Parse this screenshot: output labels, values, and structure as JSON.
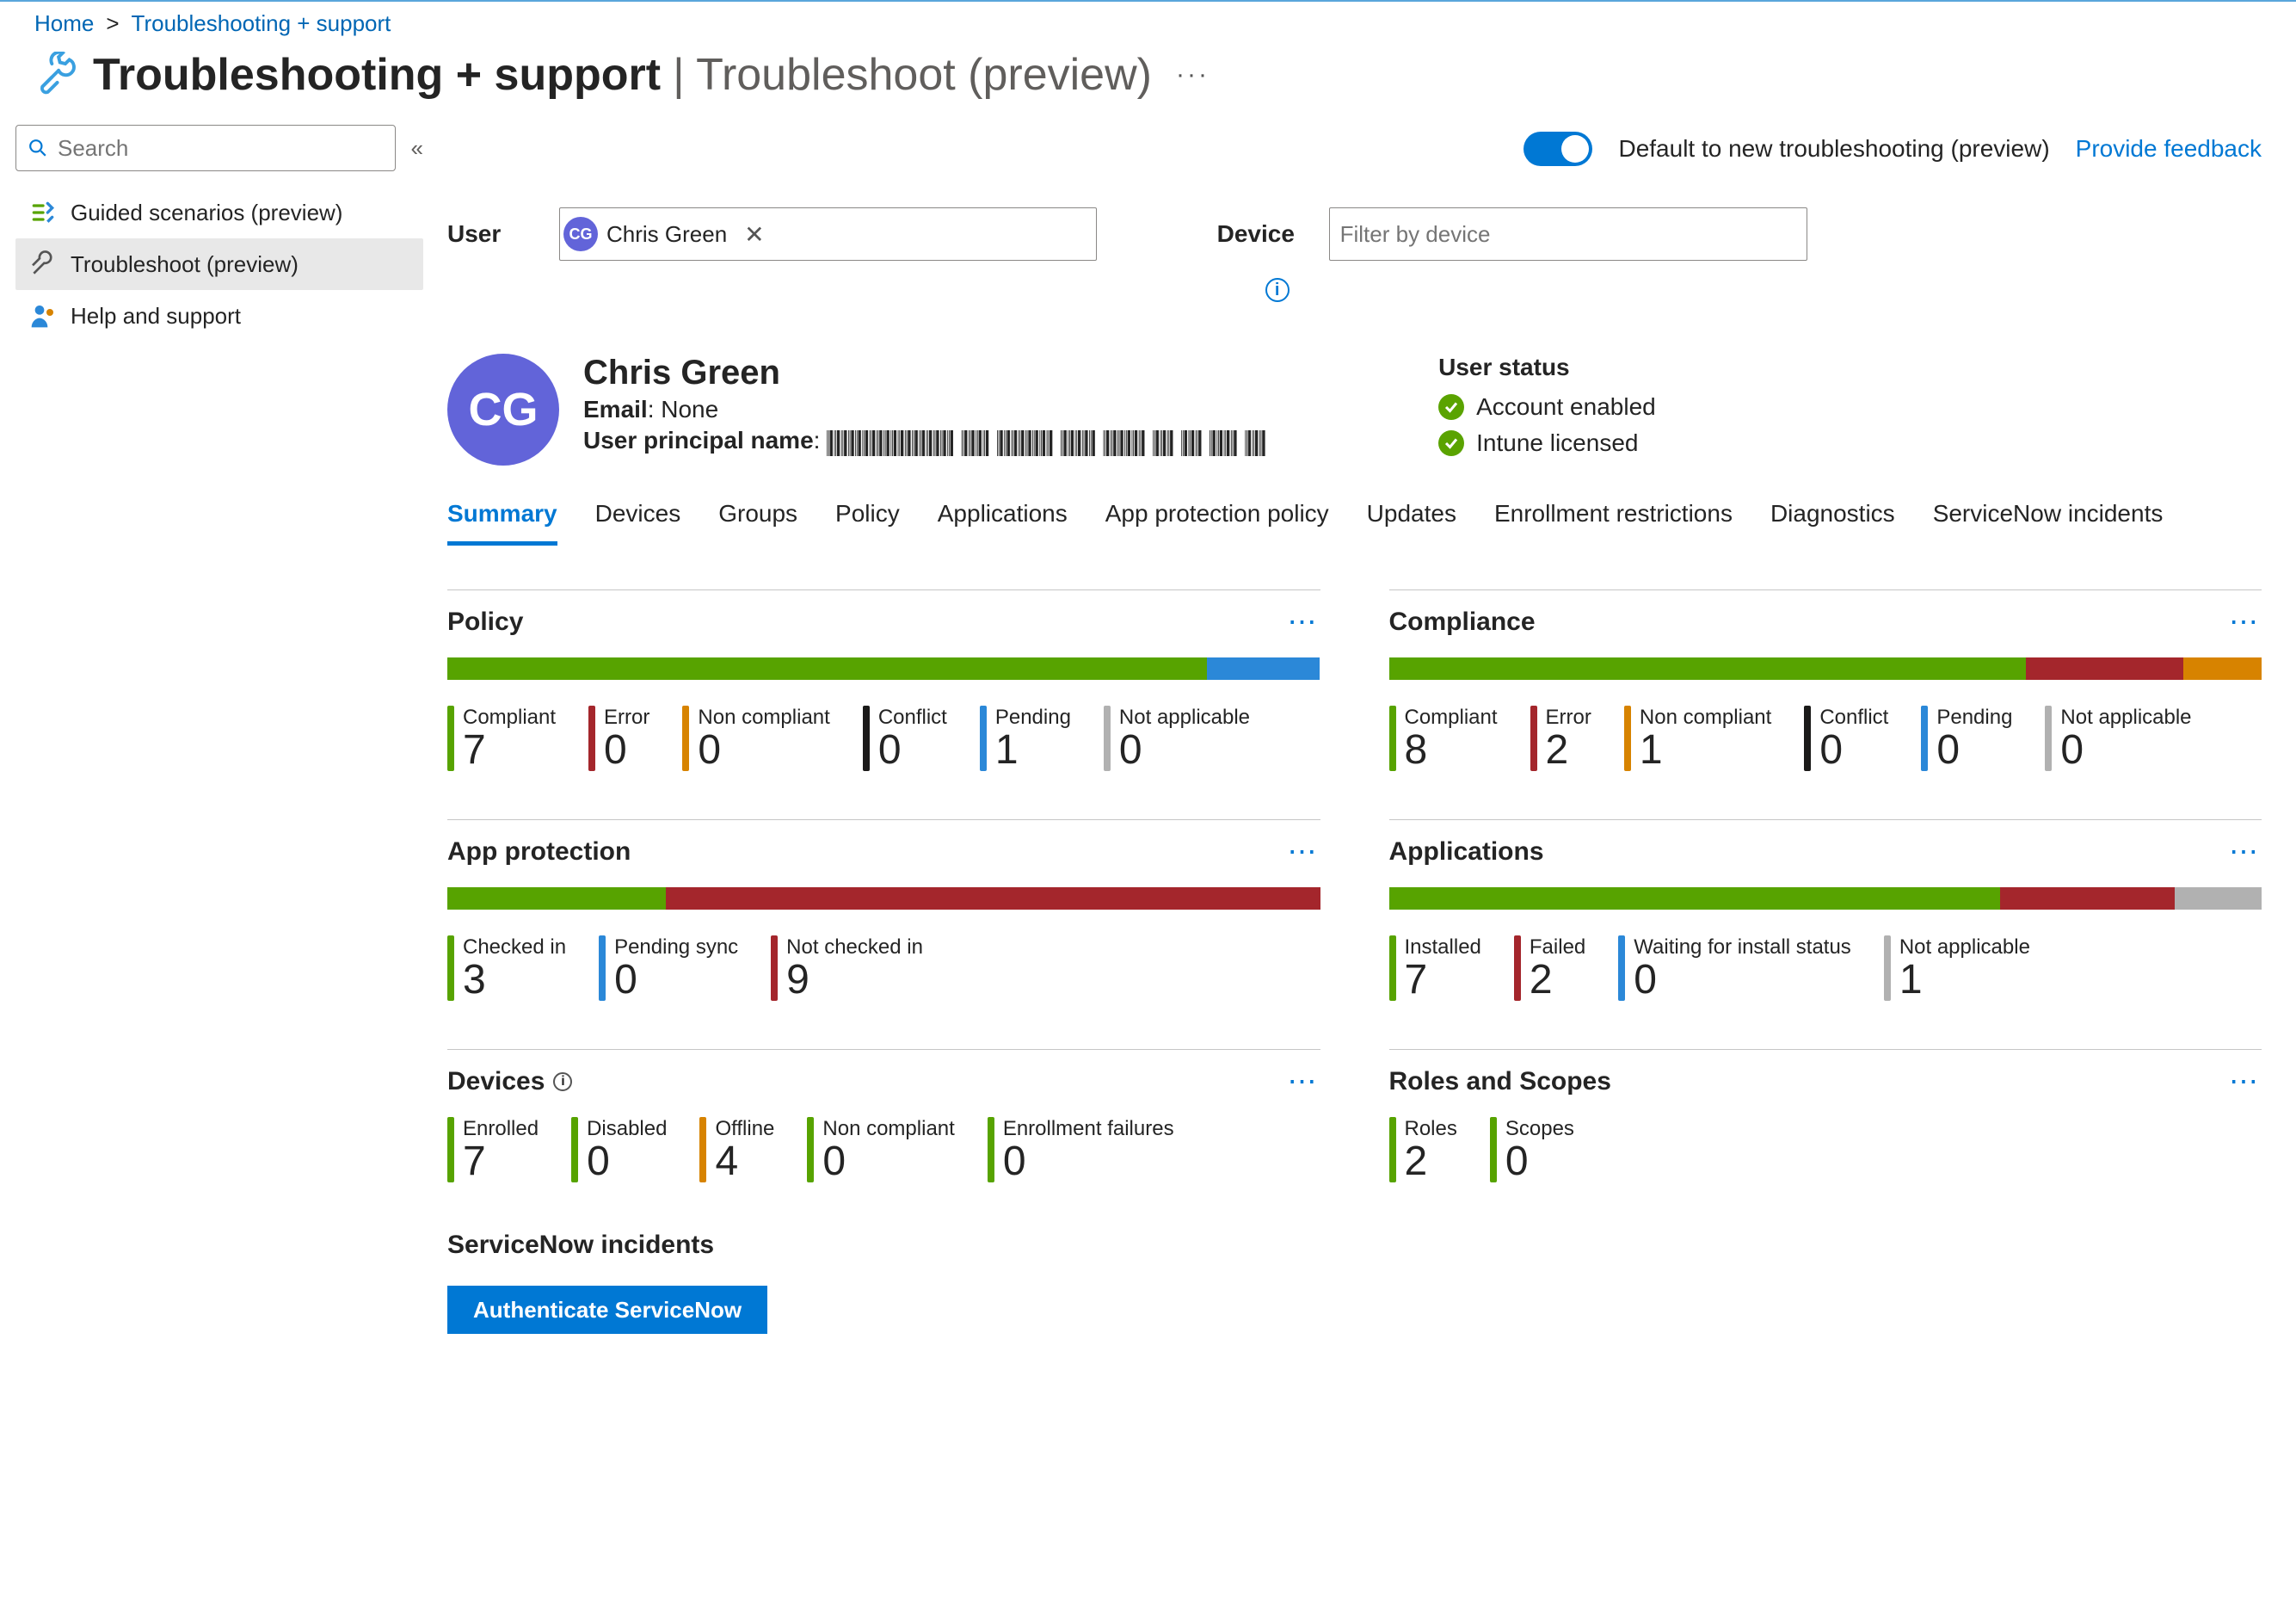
{
  "breadcrumb": {
    "home": "Home",
    "current": "Troubleshooting + support"
  },
  "title": {
    "main": "Troubleshooting + support",
    "sub": "Troubleshoot (preview)"
  },
  "sidebar": {
    "search_placeholder": "Search",
    "items": [
      {
        "label": "Guided scenarios (preview)"
      },
      {
        "label": "Troubleshoot (preview)"
      },
      {
        "label": "Help and support"
      }
    ]
  },
  "toolbar": {
    "toggle_label": "Default to new troubleshooting (preview)",
    "feedback": "Provide feedback"
  },
  "filters": {
    "user_label": "User",
    "user_chip": "Chris Green",
    "user_initials": "CG",
    "device_label": "Device",
    "device_placeholder": "Filter by device"
  },
  "user": {
    "initials": "CG",
    "name": "Chris Green",
    "email_label": "Email",
    "email_value": "None",
    "upn_label": "User principal name",
    "upn_value": "|||||||||||||||||| |||| |||||||| ||||| |||||| ||| ||| |||| |||"
  },
  "status": {
    "title": "User status",
    "rows": [
      {
        "label": "Account enabled"
      },
      {
        "label": "Intune licensed"
      }
    ]
  },
  "tabs": [
    "Summary",
    "Devices",
    "Groups",
    "Policy",
    "Applications",
    "App protection policy",
    "Updates",
    "Enrollment restrictions",
    "Diagnostics",
    "ServiceNow incidents"
  ],
  "cards": {
    "policy": {
      "title": "Policy",
      "bar": [
        {
          "c": "c-green",
          "w": 87
        },
        {
          "c": "c-blue",
          "w": 13
        }
      ],
      "metrics": [
        {
          "label": "Compliant",
          "value": "7",
          "c": "c-green"
        },
        {
          "label": "Error",
          "value": "0",
          "c": "c-red"
        },
        {
          "label": "Non compliant",
          "value": "0",
          "c": "c-orange"
        },
        {
          "label": "Conflict",
          "value": "0",
          "c": "c-black"
        },
        {
          "label": "Pending",
          "value": "1",
          "c": "c-blue"
        },
        {
          "label": "Not applicable",
          "value": "0",
          "c": "c-grey"
        }
      ]
    },
    "compliance": {
      "title": "Compliance",
      "bar": [
        {
          "c": "c-green",
          "w": 73
        },
        {
          "c": "c-red",
          "w": 18
        },
        {
          "c": "c-orange",
          "w": 9
        }
      ],
      "metrics": [
        {
          "label": "Compliant",
          "value": "8",
          "c": "c-green"
        },
        {
          "label": "Error",
          "value": "2",
          "c": "c-red"
        },
        {
          "label": "Non compliant",
          "value": "1",
          "c": "c-orange"
        },
        {
          "label": "Conflict",
          "value": "0",
          "c": "c-black"
        },
        {
          "label": "Pending",
          "value": "0",
          "c": "c-blue"
        },
        {
          "label": "Not applicable",
          "value": "0",
          "c": "c-grey"
        }
      ]
    },
    "app_protection": {
      "title": "App protection",
      "bar": [
        {
          "c": "c-green",
          "w": 25
        },
        {
          "c": "c-red",
          "w": 75
        }
      ],
      "metrics": [
        {
          "label": "Checked in",
          "value": "3",
          "c": "c-green"
        },
        {
          "label": "Pending sync",
          "value": "0",
          "c": "c-blue"
        },
        {
          "label": "Not checked in",
          "value": "9",
          "c": "c-red"
        }
      ]
    },
    "applications": {
      "title": "Applications",
      "bar": [
        {
          "c": "c-green",
          "w": 70
        },
        {
          "c": "c-red",
          "w": 20
        },
        {
          "c": "c-grey",
          "w": 10
        }
      ],
      "metrics": [
        {
          "label": "Installed",
          "value": "7",
          "c": "c-green"
        },
        {
          "label": "Failed",
          "value": "2",
          "c": "c-red"
        },
        {
          "label": "Waiting for install status",
          "value": "0",
          "c": "c-blue"
        },
        {
          "label": "Not applicable",
          "value": "1",
          "c": "c-grey"
        }
      ]
    },
    "devices": {
      "title": "Devices",
      "info": true,
      "bar": null,
      "metrics": [
        {
          "label": "Enrolled",
          "value": "7",
          "c": "c-green"
        },
        {
          "label": "Disabled",
          "value": "0",
          "c": "c-green"
        },
        {
          "label": "Offline",
          "value": "4",
          "c": "c-orange"
        },
        {
          "label": "Non compliant",
          "value": "0",
          "c": "c-green"
        },
        {
          "label": "Enrollment failures",
          "value": "0",
          "c": "c-green"
        }
      ]
    },
    "roles": {
      "title": "Roles and Scopes",
      "bar": null,
      "metrics": [
        {
          "label": "Roles",
          "value": "2",
          "c": "c-green"
        },
        {
          "label": "Scopes",
          "value": "0",
          "c": "c-green"
        }
      ]
    }
  },
  "servicenow": {
    "title": "ServiceNow incidents",
    "button": "Authenticate ServiceNow"
  }
}
